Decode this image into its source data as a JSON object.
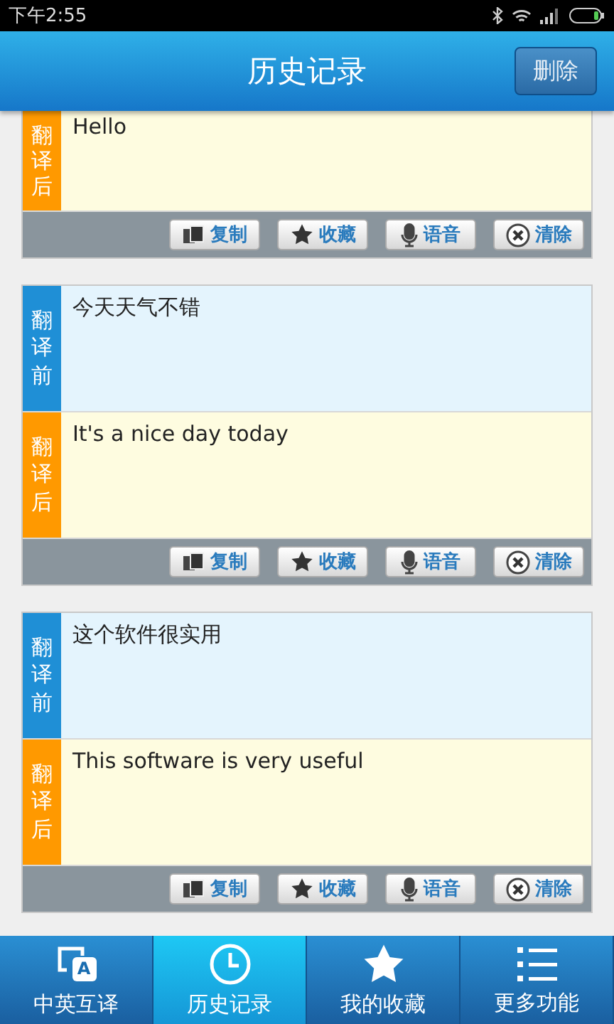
{
  "status_bar": {
    "time": "下午2:55"
  },
  "header": {
    "title": "历史记录",
    "delete_button": "删除"
  },
  "records": [
    {
      "sections": [
        {
          "kind": "after",
          "label": "翻译后",
          "text": "Hello"
        }
      ],
      "actions": [
        {
          "kind": "copy",
          "label": "复制"
        },
        {
          "kind": "favorite",
          "label": "收藏"
        },
        {
          "kind": "voice",
          "label": "语音"
        },
        {
          "kind": "clear",
          "label": "清除"
        }
      ]
    },
    {
      "sections": [
        {
          "kind": "before",
          "label": "翻译前",
          "text": "今天天气不错"
        },
        {
          "kind": "after",
          "label": "翻译后",
          "text": "It's a nice day today"
        }
      ],
      "actions": [
        {
          "kind": "copy",
          "label": "复制"
        },
        {
          "kind": "favorite",
          "label": "收藏"
        },
        {
          "kind": "voice",
          "label": "语音"
        },
        {
          "kind": "clear",
          "label": "清除"
        }
      ]
    },
    {
      "sections": [
        {
          "kind": "before",
          "label": "翻译前",
          "text": "这个软件很实用"
        },
        {
          "kind": "after",
          "label": "翻译后",
          "text": "This software is very useful"
        }
      ],
      "actions": [
        {
          "kind": "copy",
          "label": "复制"
        },
        {
          "kind": "favorite",
          "label": "收藏"
        },
        {
          "kind": "voice",
          "label": "语音"
        },
        {
          "kind": "clear",
          "label": "清除"
        }
      ]
    }
  ],
  "tabs": [
    {
      "kind": "translate",
      "label": "中英互译",
      "icon_letter": "A",
      "selected": false
    },
    {
      "kind": "history",
      "label": "历史记录",
      "selected": true
    },
    {
      "kind": "favorites",
      "label": "我的收藏",
      "selected": false
    },
    {
      "kind": "more",
      "label": "更多功能",
      "selected": false
    }
  ]
}
